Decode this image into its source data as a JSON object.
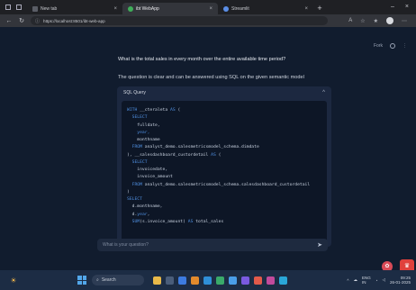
{
  "browser": {
    "tabs": [
      {
        "title": "New tab",
        "icon": "new-tab-icon",
        "active": false
      },
      {
        "title": "ibt WebApp",
        "icon": "webapp-icon",
        "active": true
      },
      {
        "title": "Streamlit",
        "icon": "streamlit-icon",
        "active": false
      }
    ],
    "new_tab_glyph": "+",
    "url": "https://localhost:8501/ibt-web-app"
  },
  "app": {
    "toolbar": {
      "menu_label": "Fork"
    },
    "question": "What is the total sales in every month over the entire available time period?",
    "answer": "The question is clear and can be answered using SQL on the given semantic model",
    "sql_panel": {
      "title": "SQL Query",
      "lines": [
        [
          [
            "kw",
            "WITH "
          ],
          [
            "id",
            "__cteraleta "
          ],
          [
            "kw",
            "AS"
          ],
          [
            "id",
            " ("
          ]
        ],
        [
          [
            "kw",
            "  SELECT"
          ]
        ],
        [
          [
            "id",
            "    fulldate,"
          ]
        ],
        [
          [
            "kw",
            "    year,"
          ]
        ],
        [
          [
            "id",
            "    monthname"
          ]
        ],
        [
          [
            "kw",
            "  FROM "
          ],
          [
            "id",
            "analyst_demo.salesmetricsmodel_schema.dimdate"
          ]
        ],
        [
          [
            "id",
            "), __salesdashboard_custordetail "
          ],
          [
            "kw",
            "AS"
          ],
          [
            "id",
            " ("
          ]
        ],
        [
          [
            "kw",
            "  SELECT"
          ]
        ],
        [
          [
            "id",
            "    invoicedate,"
          ]
        ],
        [
          [
            "id",
            "    invoice_amount"
          ]
        ],
        [
          [
            "kw",
            "  FROM "
          ],
          [
            "id",
            "analyst_demo.salesmetricsmodel_schema.salesdashboard_custordetail"
          ]
        ],
        [
          [
            "id",
            ")"
          ]
        ],
        [
          [
            "kw",
            "SELECT"
          ]
        ],
        [
          [
            "id",
            "  d.monthname,"
          ]
        ],
        [
          [
            "id",
            "  d."
          ],
          [
            "kw",
            "year"
          ],
          [
            "id",
            ","
          ]
        ],
        [
          [
            "kw",
            "  SUM"
          ],
          [
            "id",
            "(s.invoice_amount) "
          ],
          [
            "kw",
            "AS"
          ],
          [
            "id",
            " total_sales"
          ]
        ]
      ]
    },
    "chat_input": {
      "placeholder": "What is your question?"
    }
  },
  "taskbar": {
    "search_label": "Search",
    "tray": {
      "lang": "ENG",
      "region": "IN",
      "time": "09:25",
      "date": "26-01-2025"
    }
  },
  "colors": {
    "accent": "#4f8fe0",
    "background": "#111c2e",
    "panel": "#1c2840"
  }
}
